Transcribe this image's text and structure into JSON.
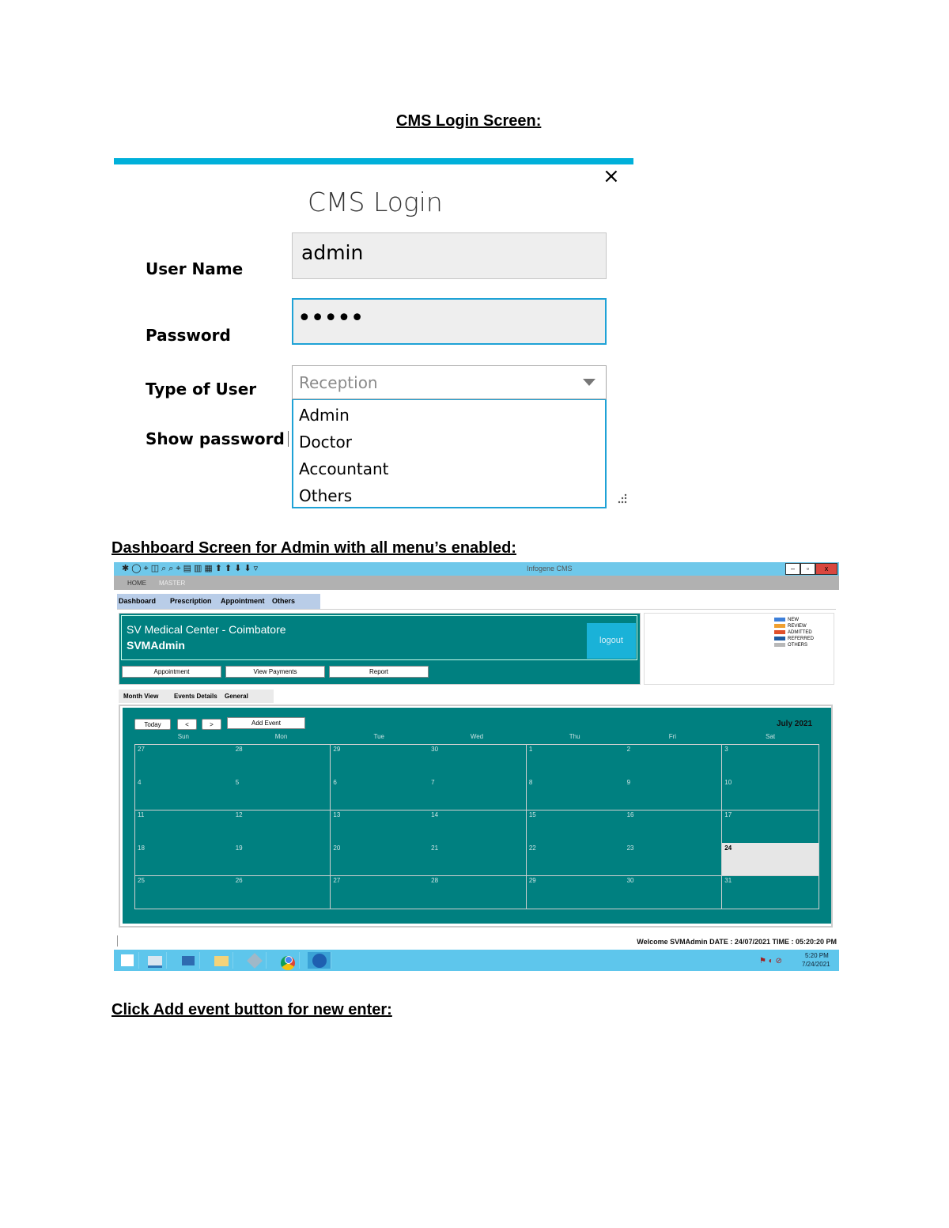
{
  "headings": {
    "login_screen": "CMS Login Screen:",
    "dashboard_screen": "Dashboard Screen for Admin with all menu’s enabled:",
    "add_event": "Click Add event button for new enter:"
  },
  "login": {
    "title": "CMS Login",
    "close_glyph": "×",
    "username_label": "User Name",
    "username_value": "admin",
    "password_label": "Password",
    "password_value": "•••••",
    "user_type_label": "Type of User",
    "user_type_selected": "Reception",
    "user_type_options": [
      "Admin",
      "Doctor",
      "Accountant",
      "Others"
    ],
    "show_password_label": "Show password",
    "colors": {
      "accent": "#00b0da",
      "field_bg": "#eeeeee",
      "focus_border": "#1ea2d6"
    }
  },
  "dashboard": {
    "window_title": "Infogene CMS",
    "window_controls": [
      "–",
      "▫",
      "x"
    ],
    "menu": [
      "HOME",
      "MASTER"
    ],
    "tabs": [
      "Dashboard",
      "Prescription",
      "Appointment",
      "Others"
    ],
    "center_name": "SV Medical Center - Coimbatore",
    "user_name": "SVMAdmin",
    "logout_label": "logout",
    "action_buttons": [
      "Appointment",
      "View Payments",
      "Report"
    ],
    "legend": [
      "NEW",
      "REVIEW",
      "ADMITTED",
      "REFERRED",
      "OTHERS"
    ],
    "legend_colors": [
      "#3d7fd9",
      "#f0a030",
      "#e0502a",
      "#1f5aa0",
      "#b8b8b8"
    ],
    "subtabs": [
      "Month View",
      "Events Details",
      "General"
    ],
    "calendar": {
      "today_label": "Today",
      "prev_label": "<",
      "next_label": ">",
      "add_event_label": "Add Event",
      "month_label": "July 2021",
      "weekdays": [
        "Sun",
        "Mon",
        "Tue",
        "Wed",
        "Thu",
        "Fri",
        "Sat"
      ],
      "days": [
        [
          "27",
          "28",
          "29",
          "30",
          "1",
          "2",
          "3"
        ],
        [
          "4",
          "5",
          "6",
          "7",
          "8",
          "9",
          "10"
        ],
        [
          "11",
          "12",
          "13",
          "14",
          "15",
          "16",
          "17"
        ],
        [
          "18",
          "19",
          "20",
          "21",
          "22",
          "23",
          "24"
        ],
        [
          "25",
          "26",
          "27",
          "28",
          "29",
          "30",
          "31"
        ]
      ],
      "highlight_day": "24",
      "colors": {
        "teal": "#008080",
        "highlight": "#e6e6e6"
      }
    },
    "status_bar": "Welcome SVMAdmin DATE : 24/07/2021 TIME : 05:20:20 PM",
    "taskbar": {
      "time": "5:20 PM",
      "date": "7/24/2021"
    }
  }
}
